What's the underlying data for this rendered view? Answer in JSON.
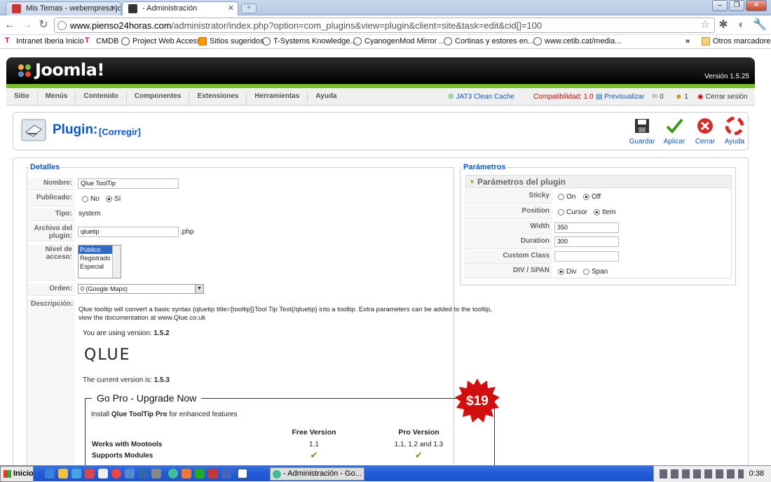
{
  "browser": {
    "tabs": [
      {
        "title": "Mis Temas - webempresa joom"
      },
      {
        "title": "- Administración"
      }
    ],
    "url_domain": "www.pienso24horas.com",
    "url_path": "/administrator/index.php?option=com_plugins&view=plugin&client=site&task=edit&cid[]=100",
    "bookmarks": [
      "Intranet Iberia Inicio",
      "CMDB",
      "Project Web Access",
      "Sitios sugeridos",
      "T-Systems Knowledge...",
      "CyanogenMod Mirror ...",
      "Cortinas y estores en...",
      "www.cetib.cat/media..."
    ],
    "other_bookmarks": "Otros marcadores",
    "overflow": "»"
  },
  "joomla": {
    "logo": "Joomla!",
    "version": "Versión 1.5.25",
    "menu": [
      "Sitio",
      "Menús",
      "Contenido",
      "Componentes",
      "Extensiones",
      "Herramientas",
      "Ayuda"
    ],
    "right": {
      "cache": "JAT3 Clean Cache",
      "compat": "Compatibilidad: 1.0",
      "preview": "Previsualizar",
      "msgs": "0",
      "users": "1",
      "logout": "Cerrar sesión"
    }
  },
  "toolbar": {
    "title": "Plugin:",
    "subtitle": "[Corregir]",
    "save": "Guardar",
    "apply": "Aplicar",
    "close": "Cerrar",
    "help": "Ayuda"
  },
  "details": {
    "legend": "Detalles",
    "name_label": "Nombre:",
    "name_value": "Qlue ToolTip",
    "published_label": "Publicado:",
    "published_no": "No",
    "published_yes": "Sí",
    "type_label": "Tipo:",
    "type_value": "system",
    "file_label": "Archivo del plugin:",
    "file_value": "qluetip",
    "file_ext": ".php",
    "access_label": "Nivel de acceso:",
    "access_options": [
      "Público",
      "Registrado",
      "Especial"
    ],
    "order_label": "Orden:",
    "order_value": "0 (Google Maps)",
    "desc_label": "Descripción:",
    "desc_text": "Qlue tooltip will convert a basic syntax {qluetip title=[tooltip]}Tool Tip Text{/qluetip} into a tooltip. Extra parameters can be added to the tooltip, view the documentation at www.Qlue.co.uk",
    "using_version_prefix": "You are using version:",
    "using_version": "1.5.2",
    "brand": "QLUE",
    "current_version_prefix": "The current version is:",
    "current_version": "1.5.3",
    "gopro_title": "Go Pro - Upgrade Now",
    "gopro_install_prefix": "Install",
    "gopro_install_product": "Qlue ToolTip Pro",
    "gopro_install_suffix": "for enhanced features",
    "price": "$19",
    "col_free": "Free Version",
    "col_pro": "Pro Version",
    "rows": [
      {
        "feature": "Works with Mootools",
        "free": "1.1",
        "pro": "1.1, 1.2 and 1.3"
      },
      {
        "feature": "Supports Modules",
        "free": "✔",
        "pro": "✔"
      }
    ]
  },
  "params": {
    "legend": "Parámetros",
    "header": "Parámetros del plugin",
    "sticky_label": "Sticky",
    "sticky_on": "On",
    "sticky_off": "Off",
    "position_label": "Position",
    "position_cursor": "Cursor",
    "position_item": "Item",
    "width_label": "Width",
    "width_value": "350",
    "duration_label": "Duration",
    "duration_value": "300",
    "class_label": "Custom Class",
    "class_value": "",
    "div_label": "DIV / SPAN",
    "div_div": "Div",
    "div_span": "Span"
  },
  "taskbar": {
    "start": "Inicio",
    "task": "- Administración - Go...",
    "clock": "0:38"
  },
  "colors": {
    "joomla_green": "#7bbc2a",
    "link_blue": "#0b55c4",
    "badge_red": "#d10f0f"
  }
}
